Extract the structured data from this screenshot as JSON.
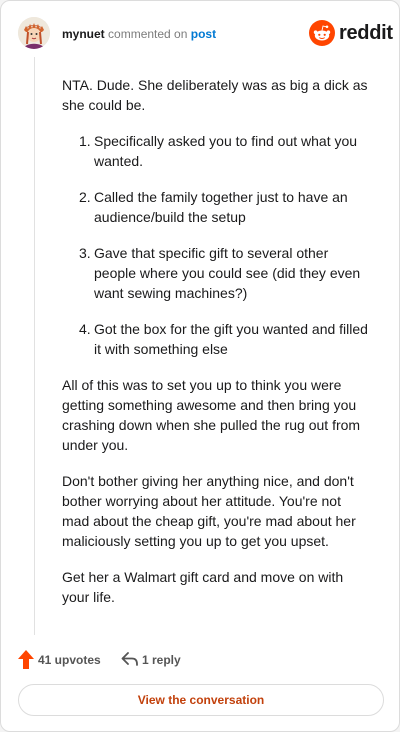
{
  "header": {
    "username": "mynuet",
    "action_text": "commented on",
    "post_link": "post",
    "brand_name": "reddit"
  },
  "comment": {
    "intro": "NTA. Dude. She deliberately was as big a dick as she could be.",
    "list": [
      {
        "number": "1.",
        "text": "Specifically asked you to find out what you wanted."
      },
      {
        "number": "2.",
        "text": "Called the family together just to have an audience/build the setup"
      },
      {
        "number": "3.",
        "text": "Gave that specific gift to several other people where you could see (did they even want sewing machines?)"
      },
      {
        "number": "4.",
        "text": "Got the box for the gift you wanted and filled it with something else"
      }
    ],
    "paragraphs": [
      "All of this was to set you up to think you were getting something awesome and then bring you crashing down when she pulled the rug out from under you.",
      "Don't bother giving her anything nice, and don't bother worrying about her attitude. You're not mad about the cheap gift, you're mad about her maliciously setting you up to get you upset.",
      "Get her a Walmart gift card and move on with your life."
    ]
  },
  "actions": {
    "upvotes": "41 upvotes",
    "replies": "1 reply"
  },
  "footer": {
    "view_label": "View the conversation"
  },
  "colors": {
    "brand": "#ff4500",
    "link": "#0079d3",
    "view_button_text": "#c2410c"
  },
  "icons": {
    "brand": "reddit-logo-icon",
    "upvote": "upvote-arrow-icon",
    "reply": "reply-arrow-icon"
  }
}
